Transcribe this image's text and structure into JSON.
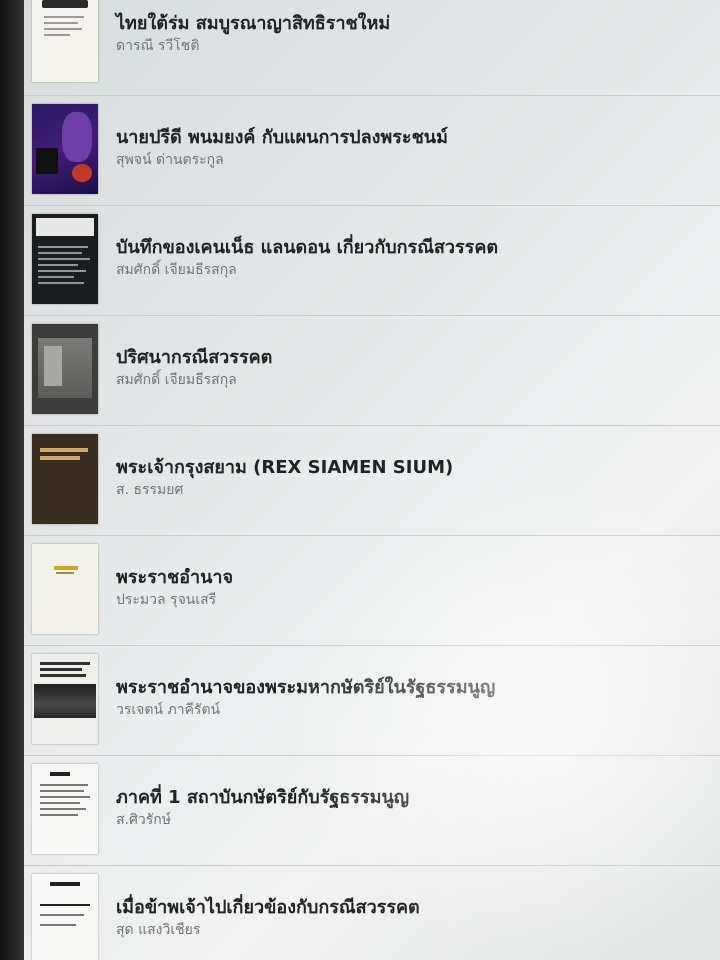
{
  "books": [
    {
      "title": "ไทยใต้ร่ม สมบูรณาญาสิทธิราชใหม่",
      "author": "ดารณี รวีโชติ",
      "cover_icon": "book-cover-icon"
    },
    {
      "title": "นายปรีดี พนมยงค์ กับแผนการปลงพระชนม์",
      "author": "สุพจน์ ด่านตระกูล",
      "cover_icon": "book-cover-icon"
    },
    {
      "title": "บันทึกของเคนเน็ธ แลนดอน เกี่ยวกับกรณีสวรรคต",
      "author": "สมศักดิ์ เจียมธีรสกุล",
      "cover_icon": "book-cover-icon"
    },
    {
      "title": "ปริศนากรณีสวรรคต",
      "author": "สมศักดิ์ เจียมธีรสกุล",
      "cover_icon": "book-cover-icon"
    },
    {
      "title": "พระเจ้ากรุงสยาม (REX SIAMEN SIUM)",
      "author": "ส. ธรรมยศ",
      "cover_icon": "book-cover-icon"
    },
    {
      "title": "พระราชอำนาจ",
      "author": "ประมวล รุจนเสรี",
      "cover_icon": "book-cover-icon"
    },
    {
      "title": "พระราชอำนาจของพระมหากษัตริย์ในรัฐธรรมนูญ",
      "author": "วรเจตน์ ภาคีรัตน์",
      "cover_icon": "book-cover-icon"
    },
    {
      "title": "ภาคที่ 1 สถาบันกษัตริย์กับรัฐธรรมนูญ",
      "author": "ส.ศิวรักษ์",
      "cover_icon": "book-cover-icon"
    },
    {
      "title": "เมื่อข้าพเจ้าไปเกี่ยวข้องกับกรณีสวรรคต",
      "author": "สุด แสงวิเชียร",
      "cover_icon": "book-cover-icon"
    }
  ],
  "colors": {
    "background": "#e6e9e9",
    "title": "#1f2324",
    "author": "#6f7476",
    "divider": "#c9cdce"
  }
}
